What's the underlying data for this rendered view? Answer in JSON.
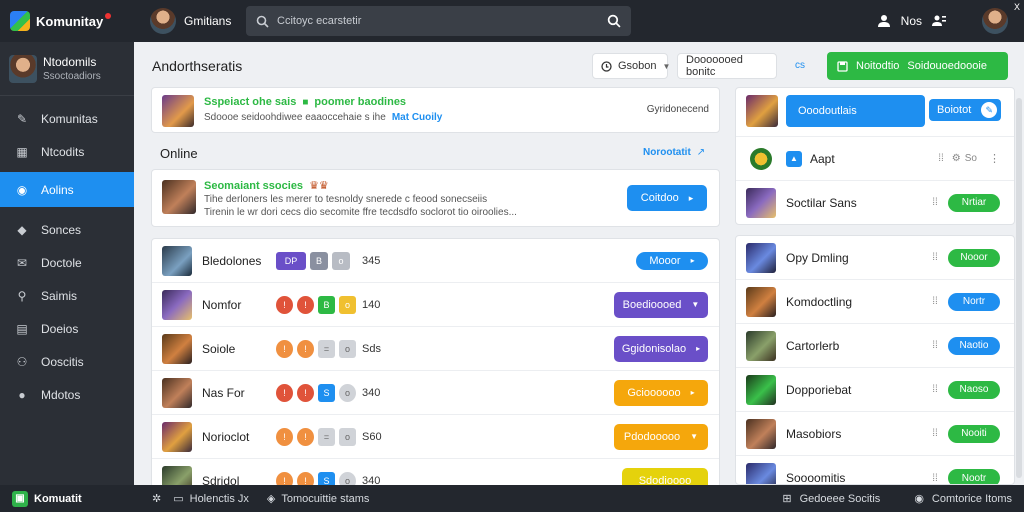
{
  "app": {
    "name": "Komunitay",
    "close": "X"
  },
  "top_user": {
    "name": "Gmitians"
  },
  "search": {
    "placeholder": "Ccitoyc ecarstetir"
  },
  "top_right": {
    "label": "Nos"
  },
  "sidebar": {
    "user": {
      "name": "Ntodomils",
      "sub": "Ssoctoadiors"
    },
    "items": [
      {
        "label": "Komunitas",
        "icon": "edit-icon"
      },
      {
        "label": "Ntcodits",
        "icon": "calendar-icon"
      },
      {
        "label": "Aolins",
        "icon": "compass-icon",
        "active": true
      },
      {
        "label": "Sonces",
        "icon": "tag-icon"
      },
      {
        "label": "Doctole",
        "icon": "mail-icon"
      },
      {
        "label": "Saimis",
        "icon": "pin-icon"
      },
      {
        "label": "Doeios",
        "icon": "document-icon"
      },
      {
        "label": "Ooscitis",
        "icon": "people-icon"
      },
      {
        "label": "Mdotos",
        "icon": "info-icon"
      }
    ]
  },
  "main": {
    "title": "Andorthseratis",
    "sort_dropdown": "Gsobon",
    "filter_dropdown": "Dooooooed bonitc",
    "filter_link": "cs",
    "green_button": {
      "label1": "Noitodtio",
      "label2": "Soidouoedoooie"
    },
    "banner1": {
      "title": "Sspeiact ohe sais",
      "title2": "poomer baodines",
      "text": "Sdoooe seidoohdiwee eaaoccehaie s ihe",
      "link": "Mat Cuoily",
      "right": "Gyridonecend"
    },
    "online": {
      "heading": "Online",
      "link": "Norootatit"
    },
    "banner2": {
      "title": "Seomaiant ssocies",
      "line1": "Tihe derloners les merer to tesnoldy snerede c feood sonecseiis",
      "line2": "Tirenin le wr dori cecs dio secomite ffre tecdsdfo soclorot tio oiroolies...",
      "button": "Coitdoo"
    },
    "games": [
      {
        "name": "Bledolones",
        "count": "345",
        "button": "Mooor",
        "color": "#1e8ff0",
        "thumb": "t2",
        "badges": [
          "DP",
          "B",
          "o"
        ]
      },
      {
        "name": "Nomfor",
        "count": "140",
        "button": "Boedioooed",
        "color": "#6a4fc8",
        "thumb": "t3",
        "badges": [
          "!",
          "B",
          "o"
        ]
      },
      {
        "name": "Soiole",
        "count": "Sds",
        "button": "Ggidonisolao",
        "color": "#6a4fc8",
        "thumb": "t4",
        "badges": [
          "!",
          "=",
          "o"
        ]
      },
      {
        "name": "Nas For",
        "count": "340",
        "button": "Gcioooooo",
        "color": "#f5a70c",
        "thumb": "t5",
        "badges": [
          "!",
          "S",
          "o"
        ]
      },
      {
        "name": "Norioclot",
        "count": "S60",
        "button": "Pdodooooo",
        "color": "#f5a70c",
        "thumb": "t6",
        "badges": [
          "!",
          "=",
          "o"
        ]
      },
      {
        "name": "Sdridol",
        "count": "340",
        "button": "Sdodioooo",
        "color": "#e5d20c",
        "thumb": "t7",
        "badges": [
          "!",
          "S",
          "o"
        ]
      }
    ]
  },
  "right": {
    "top": {
      "button": "Ooodoutlais",
      "button2": "Boiotot",
      "app_row": "Aapt",
      "app_meta": "So",
      "row3_name": "Soctilar Sans",
      "row3_pill": "Nrtiar"
    },
    "list": [
      {
        "name": "Opy Dmling",
        "pill": "Nooor",
        "color": "#2db944",
        "thumb": "t8"
      },
      {
        "name": "Komdoctling",
        "pill": "Nortr",
        "color": "#1e8ff0",
        "thumb": "t4"
      },
      {
        "name": "Cartorlerb",
        "pill": "Naotio",
        "color": "#1e8ff0",
        "thumb": "t7"
      },
      {
        "name": "Dopporiebat",
        "pill": "Naoso",
        "color": "#2db944",
        "thumb": "t9"
      },
      {
        "name": "Masobiors",
        "pill": "Nooiti",
        "color": "#2db944",
        "thumb": "t5"
      },
      {
        "name": "Soooomitis",
        "pill": "Nootr",
        "color": "#2db944",
        "thumb": "t8"
      }
    ]
  },
  "bottom": {
    "brand": "Komuatit",
    "item1": "Holenctis Jx",
    "item2": "Tomocuittie stams",
    "right1": "Gedoeee Socitis",
    "right2": "Comtorice Itoms"
  },
  "colors": {
    "accent": "#1e8ff0",
    "green": "#2db944",
    "purple": "#6a4fc8",
    "orange": "#f5a70c"
  }
}
